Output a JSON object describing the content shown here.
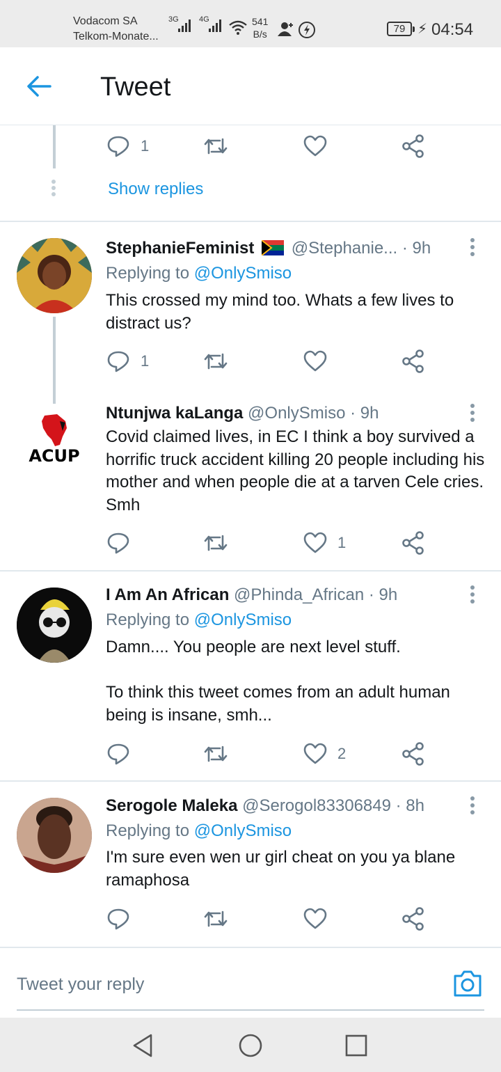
{
  "status_bar": {
    "carrier1": "Vodacom SA",
    "carrier2": "Telkom-Monate...",
    "net1": "3G",
    "net2": "4G",
    "speed_value": "541",
    "speed_unit": "B/s",
    "battery": "79",
    "time": "04:54"
  },
  "header": {
    "title": "Tweet"
  },
  "top_tweet": {
    "reply_count": "1",
    "show_replies": "Show replies"
  },
  "tweets": [
    {
      "name": "StephanieFeminist",
      "handle": "@Stephanie...",
      "time": "· 9h",
      "flag": "south-africa-flag",
      "replying_prefix": "Replying to",
      "replying_to": "@OnlySmiso",
      "text": "This crossed my mind too. Whats a few lives to distract us?",
      "reply_count": "1",
      "like_count": ""
    },
    {
      "name": "Ntunjwa kaLanga",
      "handle": "@OnlySmiso",
      "time": "· 9h",
      "avatar_label": "ACUP",
      "text": "Covid claimed lives, in EC I think a boy survived a horrific truck accident killing 20 people including his mother and when people die at a tarven Cele cries. Smh",
      "reply_count": "",
      "like_count": "1"
    },
    {
      "name": "I Am An African",
      "handle": "@Phinda_African",
      "time": "· 9h",
      "replying_prefix": "Replying to",
      "replying_to": "@OnlySmiso",
      "text": "Damn.... You people are next level stuff.\n\nTo think this tweet comes from an adult human being is insane, smh...",
      "reply_count": "",
      "like_count": "2"
    },
    {
      "name": "Serogole Maleka",
      "handle": "@Serogol83306849",
      "time": "· 8h",
      "replying_prefix": "Replying to",
      "replying_to": "@OnlySmiso",
      "text": "I'm sure even wen ur girl cheat on you ya blane ramaphosa",
      "reply_count": "",
      "like_count": ""
    }
  ],
  "reply_bar": {
    "placeholder": "Tweet your reply"
  },
  "colors": {
    "accent": "#1b95e0",
    "icon": "#657786",
    "thread": "#c4cfd6"
  }
}
